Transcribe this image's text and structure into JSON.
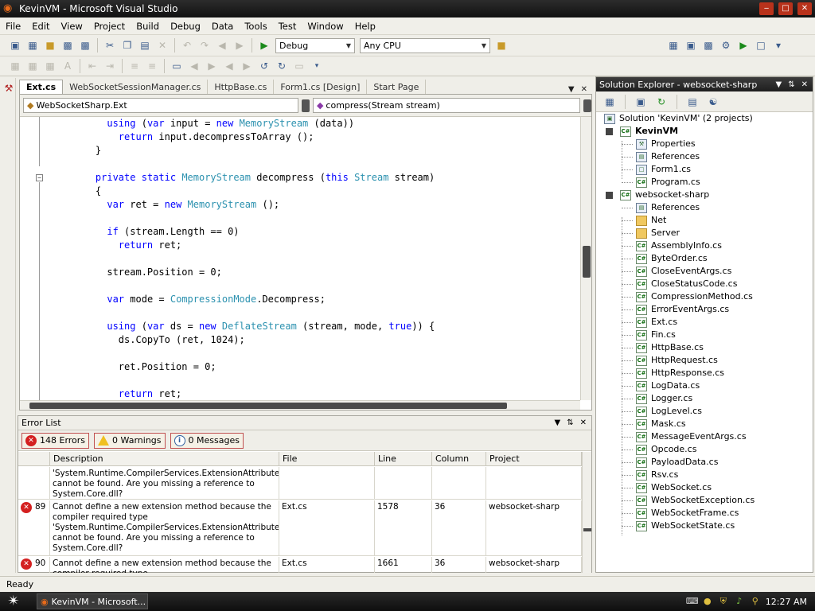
{
  "window": {
    "title": "KevinVM - Microsoft Visual Studio",
    "min": "‒",
    "max": "□",
    "close": "✕"
  },
  "menu": [
    "File",
    "Edit",
    "View",
    "Project",
    "Build",
    "Debug",
    "Data",
    "Tools",
    "Test",
    "Window",
    "Help"
  ],
  "toolbar": {
    "config": "Debug",
    "platform": "Any CPU"
  },
  "tabs": [
    "Ext.cs",
    "WebSocketSessionManager.cs",
    "HttpBase.cs",
    "Form1.cs [Design]",
    "Start Page"
  ],
  "editor": {
    "class_combo": "WebSocketSharp.Ext",
    "member_combo": "compress(Stream stream)",
    "lines": [
      [
        {
          "t": "      "
        },
        {
          "t": "using",
          "c": "kw"
        },
        {
          "t": " ("
        },
        {
          "t": "var",
          "c": "kw"
        },
        {
          "t": " input = "
        },
        {
          "t": "new",
          "c": "kw"
        },
        {
          "t": " "
        },
        {
          "t": "MemoryStream",
          "c": "ty"
        },
        {
          "t": " (data))"
        }
      ],
      [
        {
          "t": "        "
        },
        {
          "t": "return",
          "c": "kw"
        },
        {
          "t": " input.decompressToArray ();"
        }
      ],
      [
        {
          "t": "    }"
        }
      ],
      [
        {
          "t": ""
        }
      ],
      [
        {
          "t": "    "
        },
        {
          "t": "private",
          "c": "kw"
        },
        {
          "t": " "
        },
        {
          "t": "static",
          "c": "kw"
        },
        {
          "t": " "
        },
        {
          "t": "MemoryStream",
          "c": "ty"
        },
        {
          "t": " decompress ("
        },
        {
          "t": "this",
          "c": "kw"
        },
        {
          "t": " "
        },
        {
          "t": "Stream",
          "c": "ty"
        },
        {
          "t": " stream)"
        }
      ],
      [
        {
          "t": "    {"
        }
      ],
      [
        {
          "t": "      "
        },
        {
          "t": "var",
          "c": "kw"
        },
        {
          "t": " ret = "
        },
        {
          "t": "new",
          "c": "kw"
        },
        {
          "t": " "
        },
        {
          "t": "MemoryStream",
          "c": "ty"
        },
        {
          "t": " ();"
        }
      ],
      [
        {
          "t": ""
        }
      ],
      [
        {
          "t": "      "
        },
        {
          "t": "if",
          "c": "kw"
        },
        {
          "t": " (stream.Length == 0)"
        }
      ],
      [
        {
          "t": "        "
        },
        {
          "t": "return",
          "c": "kw"
        },
        {
          "t": " ret;"
        }
      ],
      [
        {
          "t": ""
        }
      ],
      [
        {
          "t": "      stream.Position = 0;"
        }
      ],
      [
        {
          "t": ""
        }
      ],
      [
        {
          "t": "      "
        },
        {
          "t": "var",
          "c": "kw"
        },
        {
          "t": " mode = "
        },
        {
          "t": "CompressionMode",
          "c": "ty"
        },
        {
          "t": ".Decompress;"
        }
      ],
      [
        {
          "t": ""
        }
      ],
      [
        {
          "t": "      "
        },
        {
          "t": "using",
          "c": "kw"
        },
        {
          "t": " ("
        },
        {
          "t": "var",
          "c": "kw"
        },
        {
          "t": " ds = "
        },
        {
          "t": "new",
          "c": "kw"
        },
        {
          "t": " "
        },
        {
          "t": "DeflateStream",
          "c": "ty"
        },
        {
          "t": " (stream, mode, "
        },
        {
          "t": "true",
          "c": "kw"
        },
        {
          "t": ")) {"
        }
      ],
      [
        {
          "t": "        ds.CopyTo (ret, 1024);"
        }
      ],
      [
        {
          "t": ""
        }
      ],
      [
        {
          "t": "        ret.Position = 0;"
        }
      ],
      [
        {
          "t": ""
        }
      ],
      [
        {
          "t": "        "
        },
        {
          "t": "return",
          "c": "kw"
        },
        {
          "t": " ret;"
        }
      ]
    ]
  },
  "error_list": {
    "title": "Error List",
    "errors_btn": "148 Errors",
    "warnings_btn": "0 Warnings",
    "messages_btn": "0 Messages",
    "columns": [
      "Description",
      "File",
      "Line",
      "Column",
      "Project"
    ],
    "rows": [
      {
        "num": "",
        "desc": "'System.Runtime.CompilerServices.ExtensionAttribute' cannot be found. Are you missing a reference to System.Core.dll?",
        "file": "",
        "line": "",
        "col": "",
        "project": ""
      },
      {
        "num": "89",
        "desc": "Cannot define a new extension method because the compiler required type 'System.Runtime.CompilerServices.ExtensionAttribute' cannot be found. Are you missing a reference to System.Core.dll?",
        "file": "Ext.cs",
        "line": "1578",
        "col": "36",
        "project": "websocket-sharp"
      },
      {
        "num": "90",
        "desc": "Cannot define a new extension method because the compiler required type",
        "file": "Ext.cs",
        "line": "1661",
        "col": "36",
        "project": "websocket-sharp"
      }
    ]
  },
  "solution_explorer": {
    "title": "Solution Explorer - websocket-sharp",
    "nodes": [
      {
        "label": "Solution 'KevinVM' (2 projects)",
        "icon": "solution"
      },
      {
        "label": "KevinVM",
        "icon": "csproj"
      },
      {
        "label": "Properties",
        "icon": "props"
      },
      {
        "label": "References",
        "icon": "refs"
      },
      {
        "label": "Form1.cs",
        "icon": "form"
      },
      {
        "label": "Program.cs",
        "icon": "cs"
      },
      {
        "label": "websocket-sharp",
        "icon": "csproj"
      },
      {
        "label": "References",
        "icon": "refs"
      },
      {
        "label": "Net",
        "icon": "folder"
      },
      {
        "label": "Server",
        "icon": "folder"
      },
      {
        "label": "AssemblyInfo.cs",
        "icon": "cs"
      },
      {
        "label": "ByteOrder.cs",
        "icon": "cs"
      },
      {
        "label": "CloseEventArgs.cs",
        "icon": "cs"
      },
      {
        "label": "CloseStatusCode.cs",
        "icon": "cs"
      },
      {
        "label": "CompressionMethod.cs",
        "icon": "cs"
      },
      {
        "label": "ErrorEventArgs.cs",
        "icon": "cs"
      },
      {
        "label": "Ext.cs",
        "icon": "cs"
      },
      {
        "label": "Fin.cs",
        "icon": "cs"
      },
      {
        "label": "HttpBase.cs",
        "icon": "cs"
      },
      {
        "label": "HttpRequest.cs",
        "icon": "cs"
      },
      {
        "label": "HttpResponse.cs",
        "icon": "cs"
      },
      {
        "label": "LogData.cs",
        "icon": "cs"
      },
      {
        "label": "Logger.cs",
        "icon": "cs"
      },
      {
        "label": "LogLevel.cs",
        "icon": "cs"
      },
      {
        "label": "Mask.cs",
        "icon": "cs"
      },
      {
        "label": "MessageEventArgs.cs",
        "icon": "cs"
      },
      {
        "label": "Opcode.cs",
        "icon": "cs"
      },
      {
        "label": "PayloadData.cs",
        "icon": "cs"
      },
      {
        "label": "Rsv.cs",
        "icon": "cs"
      },
      {
        "label": "WebSocket.cs",
        "icon": "cs"
      },
      {
        "label": "WebSocketException.cs",
        "icon": "cs"
      },
      {
        "label": "WebSocketFrame.cs",
        "icon": "cs"
      },
      {
        "label": "WebSocketState.cs",
        "icon": "cs"
      }
    ]
  },
  "status": {
    "text": "Ready"
  },
  "taskbar": {
    "window_btn": "KevinVM - Microsoft...",
    "clock": "12:27 AM"
  },
  "colors": {
    "keyword": "#0000ff",
    "type": "#2b91af"
  }
}
